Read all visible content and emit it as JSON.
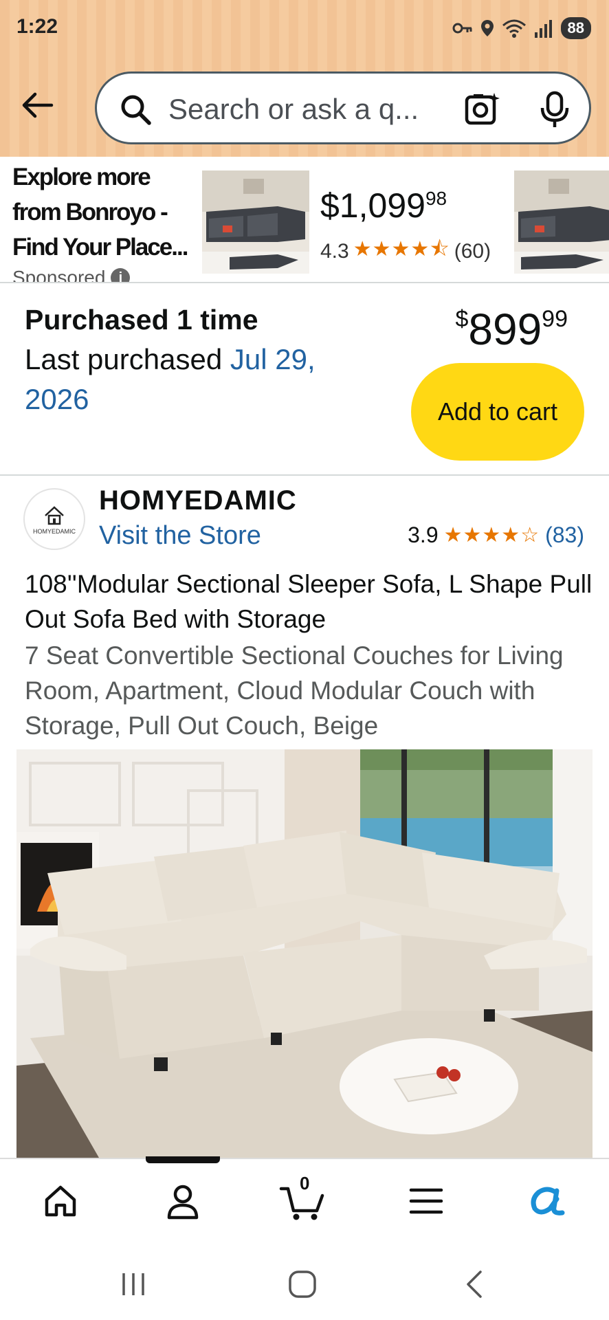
{
  "status_bar": {
    "time": "1:22",
    "battery": "88"
  },
  "search": {
    "text": "Search or ask a q..."
  },
  "sponsored": {
    "title": "Explore more from Bonroyo - Find Your Place...",
    "label": "Sponsored",
    "price_whole": "$1,099",
    "price_fraction": "98",
    "rating": "4.3",
    "stars": "★★★★⯪",
    "reviews": "(60)"
  },
  "purchase": {
    "title": "Purchased 1 time",
    "last_prefix": "Last purchased",
    "last_date": "Jul 29, 2026",
    "price_currency": "$",
    "price_whole": "899",
    "price_fraction": "99",
    "add_to_cart": "Add to cart"
  },
  "store": {
    "logo_text": "HOMYEDAMIC",
    "name": "HOMYEDAMIC",
    "visit": "Visit the Store",
    "rating": "3.9",
    "stars": "★★★★☆",
    "reviews": "(83)"
  },
  "product": {
    "title": "108''Modular Sectional Sleeper Sofa, L Shape Pull Out Sofa Bed with Storage",
    "subtitle": "7 Seat Convertible Sectional Couches for Living Room, Apartment, Cloud Modular Couch with Storage, Pull Out Couch, Beige"
  },
  "bottom_nav": {
    "cart_count": "0",
    "items": [
      "home-icon",
      "account-icon",
      "cart-icon",
      "menu-icon",
      "rufus-icon"
    ]
  },
  "colors": {
    "header_bg": "#f2c395",
    "link": "#2162a1",
    "add_to_cart": "#ffd814",
    "star": "#e77600"
  }
}
